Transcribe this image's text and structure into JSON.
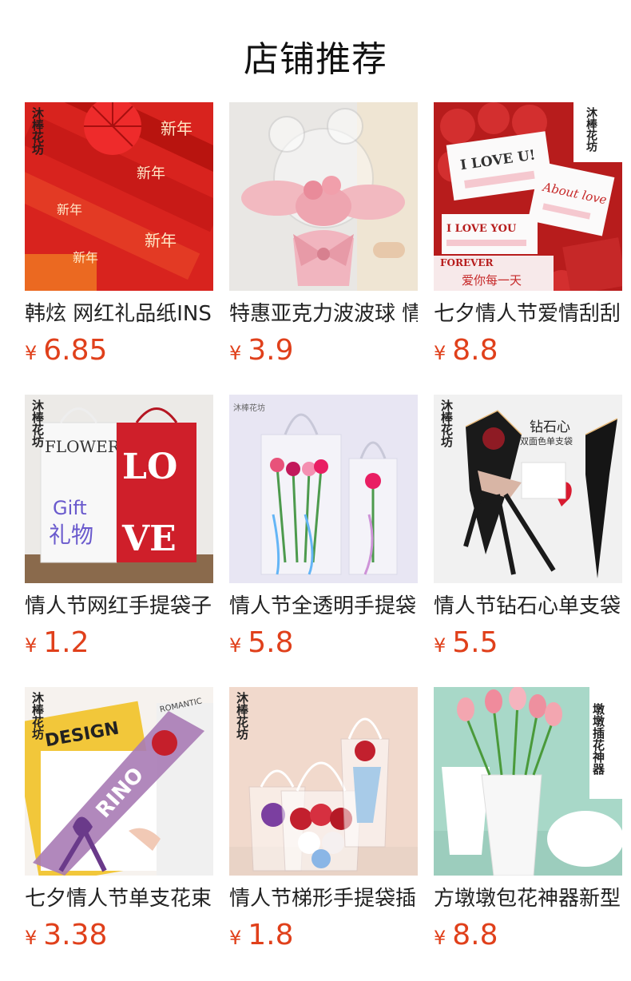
{
  "page": {
    "title": "店铺推荐",
    "currency_symbol": "¥",
    "accent_color": "#e0401b"
  },
  "products": [
    {
      "name": "韩炫 网红礼品纸INS",
      "price": "6.85",
      "image": "red-new-year-wrapping-paper"
    },
    {
      "name": "特惠亚克力波波球 情",
      "price": "3.9",
      "image": "bear-balloon-bouquet"
    },
    {
      "name": "七夕情人节爱情刮刮",
      "price": "8.8",
      "image": "love-cards-roses"
    },
    {
      "name": "情人节网红手提袋子",
      "price": "1.2",
      "image": "love-gift-bags"
    },
    {
      "name": "情人节全透明手提袋",
      "price": "5.8",
      "image": "transparent-flower-bags"
    },
    {
      "name": "情人节钻石心单支袋",
      "price": "5.5",
      "image": "diamond-heart-sleeve"
    },
    {
      "name": "七夕情人节单支花束",
      "price": "3.38",
      "image": "single-flower-sleeve"
    },
    {
      "name": "情人节梯形手提袋插",
      "price": "1.8",
      "image": "trapezoid-flower-bags"
    },
    {
      "name": "方墩墩包花神器新型",
      "price": "8.8",
      "image": "tulip-vase"
    }
  ],
  "image_text": {
    "brand": "沐棒花坊",
    "new_year": "新年",
    "flower": "FLOWER",
    "love": "LOVE",
    "gift_en": "Gift",
    "gift_cn": "礼物",
    "i_love_u": "I LOVE U!",
    "about_love": "About love",
    "i_love_you": "I LOVE YOU",
    "forever": "FOREVER",
    "love_every_day": "爱你每一天",
    "diamond_heart": "钻石心",
    "diamond_sub": "双面色单支袋",
    "design": "DESIGN",
    "romantic": "ROMANTIC",
    "tulip_title": "墩墩插花神器"
  }
}
